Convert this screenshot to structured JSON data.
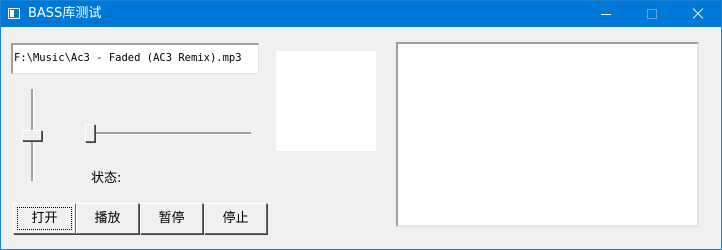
{
  "window": {
    "title": "BASS库测试",
    "controls": [
      "minimize-icon",
      "maximize-icon",
      "close-icon"
    ]
  },
  "file_path": "F:\\Music\\Ac3 - Faded (AC3 Remix).mp3",
  "volume_slider": {
    "orientation": "vertical",
    "level": 0.5
  },
  "position_slider": {
    "orientation": "horizontal",
    "level": 0.0
  },
  "status": {
    "label": "状态:"
  },
  "buttons": {
    "open": "打开",
    "play": "播放",
    "pause": "暂停",
    "stop": "停止"
  },
  "colors": {
    "titlebar": "#0078d7",
    "window_bg": "#f0f0f0",
    "panel_bg": "#ffffff"
  }
}
